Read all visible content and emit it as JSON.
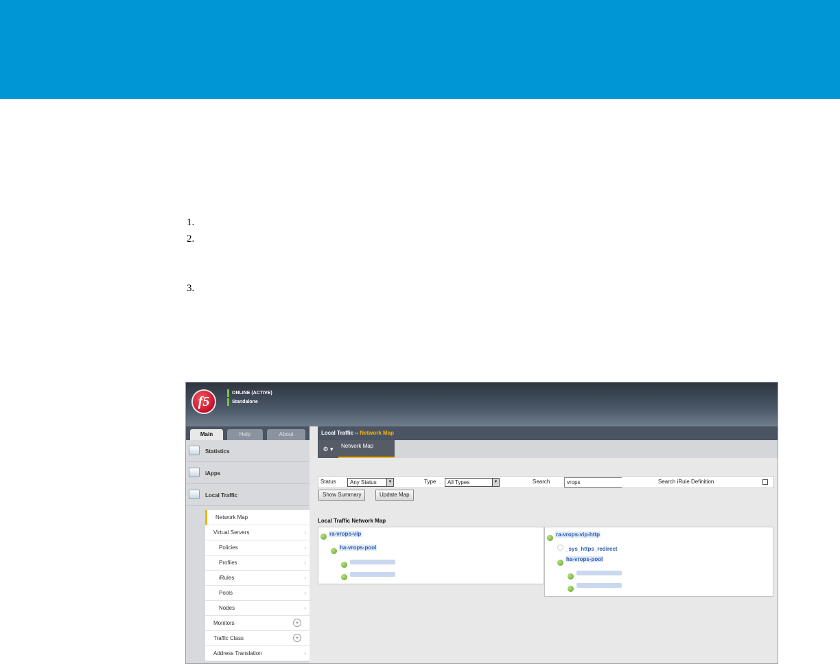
{
  "steps": [
    "1.",
    "2.",
    "3."
  ],
  "app": {
    "logo": "f5",
    "status_online": "ONLINE (ACTIVE)",
    "status_mode": "Standalone",
    "accent_color": "#f5b400",
    "banner_color": "#0096d6"
  },
  "tabs": [
    "Main",
    "Help",
    "About"
  ],
  "sidebar": {
    "sections": [
      "Statistics",
      "iApps",
      "Local Traffic"
    ],
    "items": [
      {
        "label": "Network Map"
      },
      {
        "label": "Virtual Servers"
      },
      {
        "label": "Policies"
      },
      {
        "label": "Profiles"
      },
      {
        "label": "iRules"
      },
      {
        "label": "Pools"
      },
      {
        "label": "Nodes"
      },
      {
        "label": "Monitors"
      },
      {
        "label": "Traffic Class"
      },
      {
        "label": "Address Translation"
      }
    ]
  },
  "breadcrumb": {
    "parent": "Local Traffic",
    "separator": "››",
    "current": "Network Map"
  },
  "subtab": {
    "gear": "⚙ ▾",
    "label": "Network Map"
  },
  "filters": {
    "status_label": "Status",
    "status_value": "Any Status",
    "type_label": "Type",
    "type_value": "All Types",
    "search_label": "Search",
    "search_value": "vrops",
    "irule_label": "Search iRule Definition"
  },
  "buttons": {
    "show_summary": "Show Summary",
    "update_map": "Update Map"
  },
  "map": {
    "title": "Local Traffic Network Map",
    "left": {
      "vip": "ra-vrops-vip",
      "pool": "ha-vrops-pool"
    },
    "right": {
      "vip": "ra-vrops-vip-http",
      "irule": "_sys_https_redirect",
      "pool": "ha-vrops-pool"
    }
  }
}
